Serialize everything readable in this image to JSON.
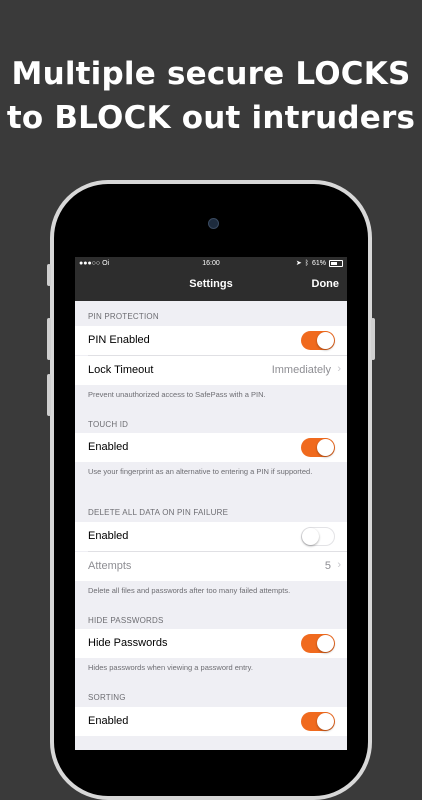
{
  "headline": {
    "line1": "Multiple secure LOCKS",
    "line2": "to BLOCK out intruders"
  },
  "status_bar": {
    "carrier": "●●●○○ Oi",
    "time": "16:00",
    "battery": "61%"
  },
  "nav": {
    "title": "Settings",
    "done_label": "Done"
  },
  "sections": {
    "pin": {
      "header": "PIN PROTECTION",
      "pin_enabled_label": "PIN Enabled",
      "pin_enabled": true,
      "lock_timeout_label": "Lock Timeout",
      "lock_timeout_value": "Immediately",
      "footer": "Prevent unauthorized access to SafePass with a PIN."
    },
    "touch_id": {
      "header": "TOUCH ID",
      "enabled_label": "Enabled",
      "enabled": true,
      "footer": "Use your fingerprint as an alternative to entering a PIN if supported."
    },
    "delete_data": {
      "header": "DELETE ALL DATA ON PIN FAILURE",
      "enabled_label": "Enabled",
      "enabled": false,
      "attempts_label": "Attempts",
      "attempts_value": "5",
      "footer": "Delete all files and passwords after too many failed attempts."
    },
    "hide_passwords": {
      "header": "HIDE PASSWORDS",
      "hide_label": "Hide Passwords",
      "enabled": true,
      "footer": "Hides passwords when viewing a password entry."
    },
    "sorting": {
      "header": "SORTING",
      "enabled_label": "Enabled",
      "enabled": true
    }
  },
  "colors": {
    "accent": "#f06a1e",
    "background": "#3a3a3a",
    "bar": "#2d2d2d"
  }
}
